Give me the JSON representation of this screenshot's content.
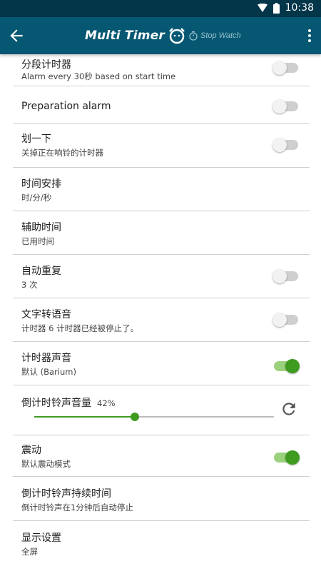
{
  "status_bar": {
    "time": "10:38",
    "wifi_icon": "wifi-icon",
    "battery_icon": "battery-icon"
  },
  "app_bar": {
    "title": "Multi Timer",
    "subtitle": "Stop Watch",
    "back_icon": "arrow-back-icon",
    "menu_icon": "more-vert-icon"
  },
  "colors": {
    "status_bar": "#04364a",
    "app_bar": "#065772",
    "accent": "#3f9b20",
    "switch_on_track": "#9bd17d"
  },
  "settings": [
    {
      "title": "分段计时器",
      "subtitle": "Alarm every 30秒 based on start time",
      "switch_on": false
    },
    {
      "title": "Preparation alarm",
      "switch_on": false
    },
    {
      "title": "划一下",
      "subtitle": "关掉正在响铃的计时器",
      "switch_on": false
    },
    {
      "title": "时间安排",
      "subtitle": "时/分/秒"
    },
    {
      "title": "辅助时间",
      "subtitle": "已用时间"
    },
    {
      "title": "自动重复",
      "subtitle": "3 次",
      "switch_on": false
    },
    {
      "title": "文字转语音",
      "subtitle": "计时器 6 计时器已经被停止了。",
      "switch_on": false
    },
    {
      "title": "计时器声音",
      "subtitle": "默认 (Barium)",
      "switch_on": true
    },
    {
      "title": "倒计时铃声音量",
      "volume_percent": "42%",
      "volume_value": 0.42
    },
    {
      "title": "震动",
      "subtitle": "默认震动模式",
      "switch_on": true
    },
    {
      "title": "倒计时铃声持续时间",
      "subtitle": "倒计时铃声在1分钟后自动停止"
    },
    {
      "title": "显示设置",
      "subtitle": "全屏"
    }
  ]
}
